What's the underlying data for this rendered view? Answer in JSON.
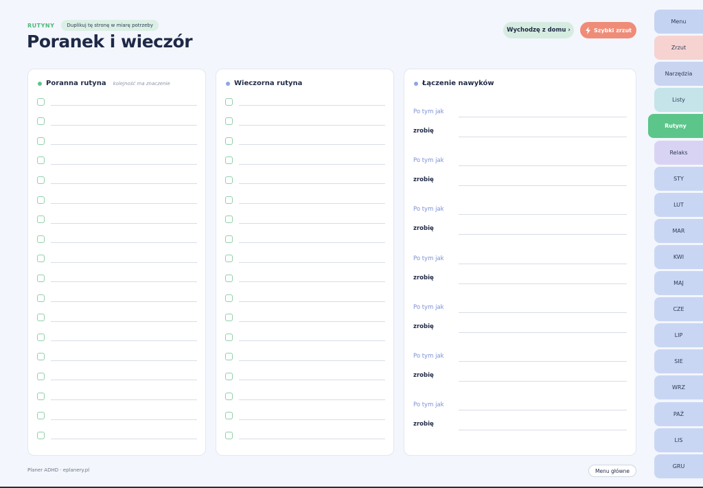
{
  "header": {
    "section_label": "RUTYNY",
    "pill": "Duplikuj tę stronę w miarę potrzeby",
    "title": "Poranek i wieczór",
    "leave_button": "Wychodzę z domu ›",
    "dump_button": "Szybki zrzut",
    "dump_icon": "lightning-icon"
  },
  "morning": {
    "title": "Poranna rutyna",
    "hint": "kolejność ma znaczenie",
    "dot_color": "#5cc58a"
  },
  "evening": {
    "title": "Wieczorna rutyna",
    "dot_color": "#8ea5e6"
  },
  "stacking": {
    "title": "Łączenie nawyków",
    "dot_color": "#8ea5e6",
    "after_label": "Po tym jak",
    "will_label": "zrobię"
  },
  "footer": {
    "brand": "Planer ADHD · eplanery.pl",
    "main_menu": "Menu główne"
  },
  "tabs": [
    {
      "label": "Menu",
      "color": "#c5d3f2"
    },
    {
      "label": "Zrzut",
      "color": "#f6d3d1"
    },
    {
      "label": "Narzędzia",
      "color": "#c9d4f1"
    },
    {
      "label": "Listy",
      "color": "#c4e4ea"
    },
    {
      "label": "Rutyny",
      "color": "#5cc58a",
      "active": true
    },
    {
      "label": "Relaks",
      "color": "#d9d3f3"
    },
    {
      "label": "STY",
      "color": "#c9d6f3"
    },
    {
      "label": "LUT",
      "color": "#c9d6f3"
    },
    {
      "label": "MAR",
      "color": "#c9d6f3"
    },
    {
      "label": "KWI",
      "color": "#c9d6f3"
    },
    {
      "label": "MAJ",
      "color": "#c9d6f3"
    },
    {
      "label": "CZE",
      "color": "#c9d6f3"
    },
    {
      "label": "LIP",
      "color": "#c9d6f3"
    },
    {
      "label": "SIE",
      "color": "#c9d6f3"
    },
    {
      "label": "WRZ",
      "color": "#c9d6f3"
    },
    {
      "label": "PAŹ",
      "color": "#c9d6f3"
    },
    {
      "label": "LIS",
      "color": "#c9d6f3"
    },
    {
      "label": "GRU",
      "color": "#c9d6f3"
    }
  ]
}
